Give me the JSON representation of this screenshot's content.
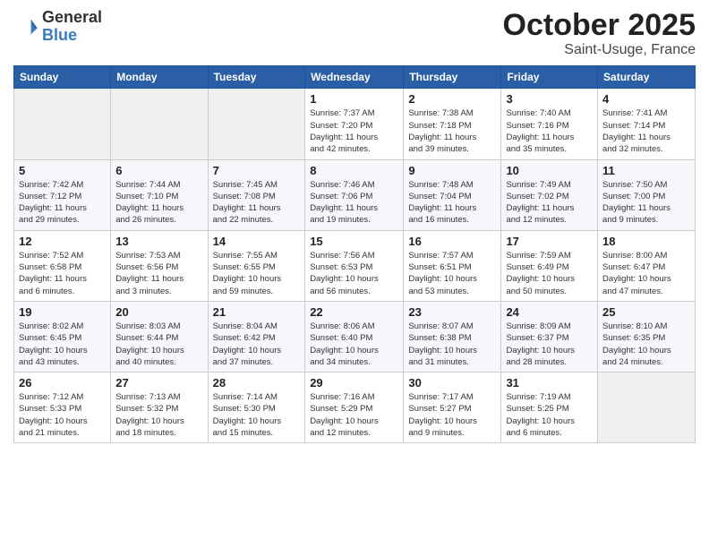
{
  "header": {
    "logo_general": "General",
    "logo_blue": "Blue",
    "month": "October 2025",
    "location": "Saint-Usuge, France"
  },
  "weekdays": [
    "Sunday",
    "Monday",
    "Tuesday",
    "Wednesday",
    "Thursday",
    "Friday",
    "Saturday"
  ],
  "weeks": [
    [
      {
        "day": "",
        "info": ""
      },
      {
        "day": "",
        "info": ""
      },
      {
        "day": "",
        "info": ""
      },
      {
        "day": "1",
        "info": "Sunrise: 7:37 AM\nSunset: 7:20 PM\nDaylight: 11 hours\nand 42 minutes."
      },
      {
        "day": "2",
        "info": "Sunrise: 7:38 AM\nSunset: 7:18 PM\nDaylight: 11 hours\nand 39 minutes."
      },
      {
        "day": "3",
        "info": "Sunrise: 7:40 AM\nSunset: 7:16 PM\nDaylight: 11 hours\nand 35 minutes."
      },
      {
        "day": "4",
        "info": "Sunrise: 7:41 AM\nSunset: 7:14 PM\nDaylight: 11 hours\nand 32 minutes."
      }
    ],
    [
      {
        "day": "5",
        "info": "Sunrise: 7:42 AM\nSunset: 7:12 PM\nDaylight: 11 hours\nand 29 minutes."
      },
      {
        "day": "6",
        "info": "Sunrise: 7:44 AM\nSunset: 7:10 PM\nDaylight: 11 hours\nand 26 minutes."
      },
      {
        "day": "7",
        "info": "Sunrise: 7:45 AM\nSunset: 7:08 PM\nDaylight: 11 hours\nand 22 minutes."
      },
      {
        "day": "8",
        "info": "Sunrise: 7:46 AM\nSunset: 7:06 PM\nDaylight: 11 hours\nand 19 minutes."
      },
      {
        "day": "9",
        "info": "Sunrise: 7:48 AM\nSunset: 7:04 PM\nDaylight: 11 hours\nand 16 minutes."
      },
      {
        "day": "10",
        "info": "Sunrise: 7:49 AM\nSunset: 7:02 PM\nDaylight: 11 hours\nand 12 minutes."
      },
      {
        "day": "11",
        "info": "Sunrise: 7:50 AM\nSunset: 7:00 PM\nDaylight: 11 hours\nand 9 minutes."
      }
    ],
    [
      {
        "day": "12",
        "info": "Sunrise: 7:52 AM\nSunset: 6:58 PM\nDaylight: 11 hours\nand 6 minutes."
      },
      {
        "day": "13",
        "info": "Sunrise: 7:53 AM\nSunset: 6:56 PM\nDaylight: 11 hours\nand 3 minutes."
      },
      {
        "day": "14",
        "info": "Sunrise: 7:55 AM\nSunset: 6:55 PM\nDaylight: 10 hours\nand 59 minutes."
      },
      {
        "day": "15",
        "info": "Sunrise: 7:56 AM\nSunset: 6:53 PM\nDaylight: 10 hours\nand 56 minutes."
      },
      {
        "day": "16",
        "info": "Sunrise: 7:57 AM\nSunset: 6:51 PM\nDaylight: 10 hours\nand 53 minutes."
      },
      {
        "day": "17",
        "info": "Sunrise: 7:59 AM\nSunset: 6:49 PM\nDaylight: 10 hours\nand 50 minutes."
      },
      {
        "day": "18",
        "info": "Sunrise: 8:00 AM\nSunset: 6:47 PM\nDaylight: 10 hours\nand 47 minutes."
      }
    ],
    [
      {
        "day": "19",
        "info": "Sunrise: 8:02 AM\nSunset: 6:45 PM\nDaylight: 10 hours\nand 43 minutes."
      },
      {
        "day": "20",
        "info": "Sunrise: 8:03 AM\nSunset: 6:44 PM\nDaylight: 10 hours\nand 40 minutes."
      },
      {
        "day": "21",
        "info": "Sunrise: 8:04 AM\nSunset: 6:42 PM\nDaylight: 10 hours\nand 37 minutes."
      },
      {
        "day": "22",
        "info": "Sunrise: 8:06 AM\nSunset: 6:40 PM\nDaylight: 10 hours\nand 34 minutes."
      },
      {
        "day": "23",
        "info": "Sunrise: 8:07 AM\nSunset: 6:38 PM\nDaylight: 10 hours\nand 31 minutes."
      },
      {
        "day": "24",
        "info": "Sunrise: 8:09 AM\nSunset: 6:37 PM\nDaylight: 10 hours\nand 28 minutes."
      },
      {
        "day": "25",
        "info": "Sunrise: 8:10 AM\nSunset: 6:35 PM\nDaylight: 10 hours\nand 24 minutes."
      }
    ],
    [
      {
        "day": "26",
        "info": "Sunrise: 7:12 AM\nSunset: 5:33 PM\nDaylight: 10 hours\nand 21 minutes."
      },
      {
        "day": "27",
        "info": "Sunrise: 7:13 AM\nSunset: 5:32 PM\nDaylight: 10 hours\nand 18 minutes."
      },
      {
        "day": "28",
        "info": "Sunrise: 7:14 AM\nSunset: 5:30 PM\nDaylight: 10 hours\nand 15 minutes."
      },
      {
        "day": "29",
        "info": "Sunrise: 7:16 AM\nSunset: 5:29 PM\nDaylight: 10 hours\nand 12 minutes."
      },
      {
        "day": "30",
        "info": "Sunrise: 7:17 AM\nSunset: 5:27 PM\nDaylight: 10 hours\nand 9 minutes."
      },
      {
        "day": "31",
        "info": "Sunrise: 7:19 AM\nSunset: 5:25 PM\nDaylight: 10 hours\nand 6 minutes."
      },
      {
        "day": "",
        "info": ""
      }
    ]
  ]
}
